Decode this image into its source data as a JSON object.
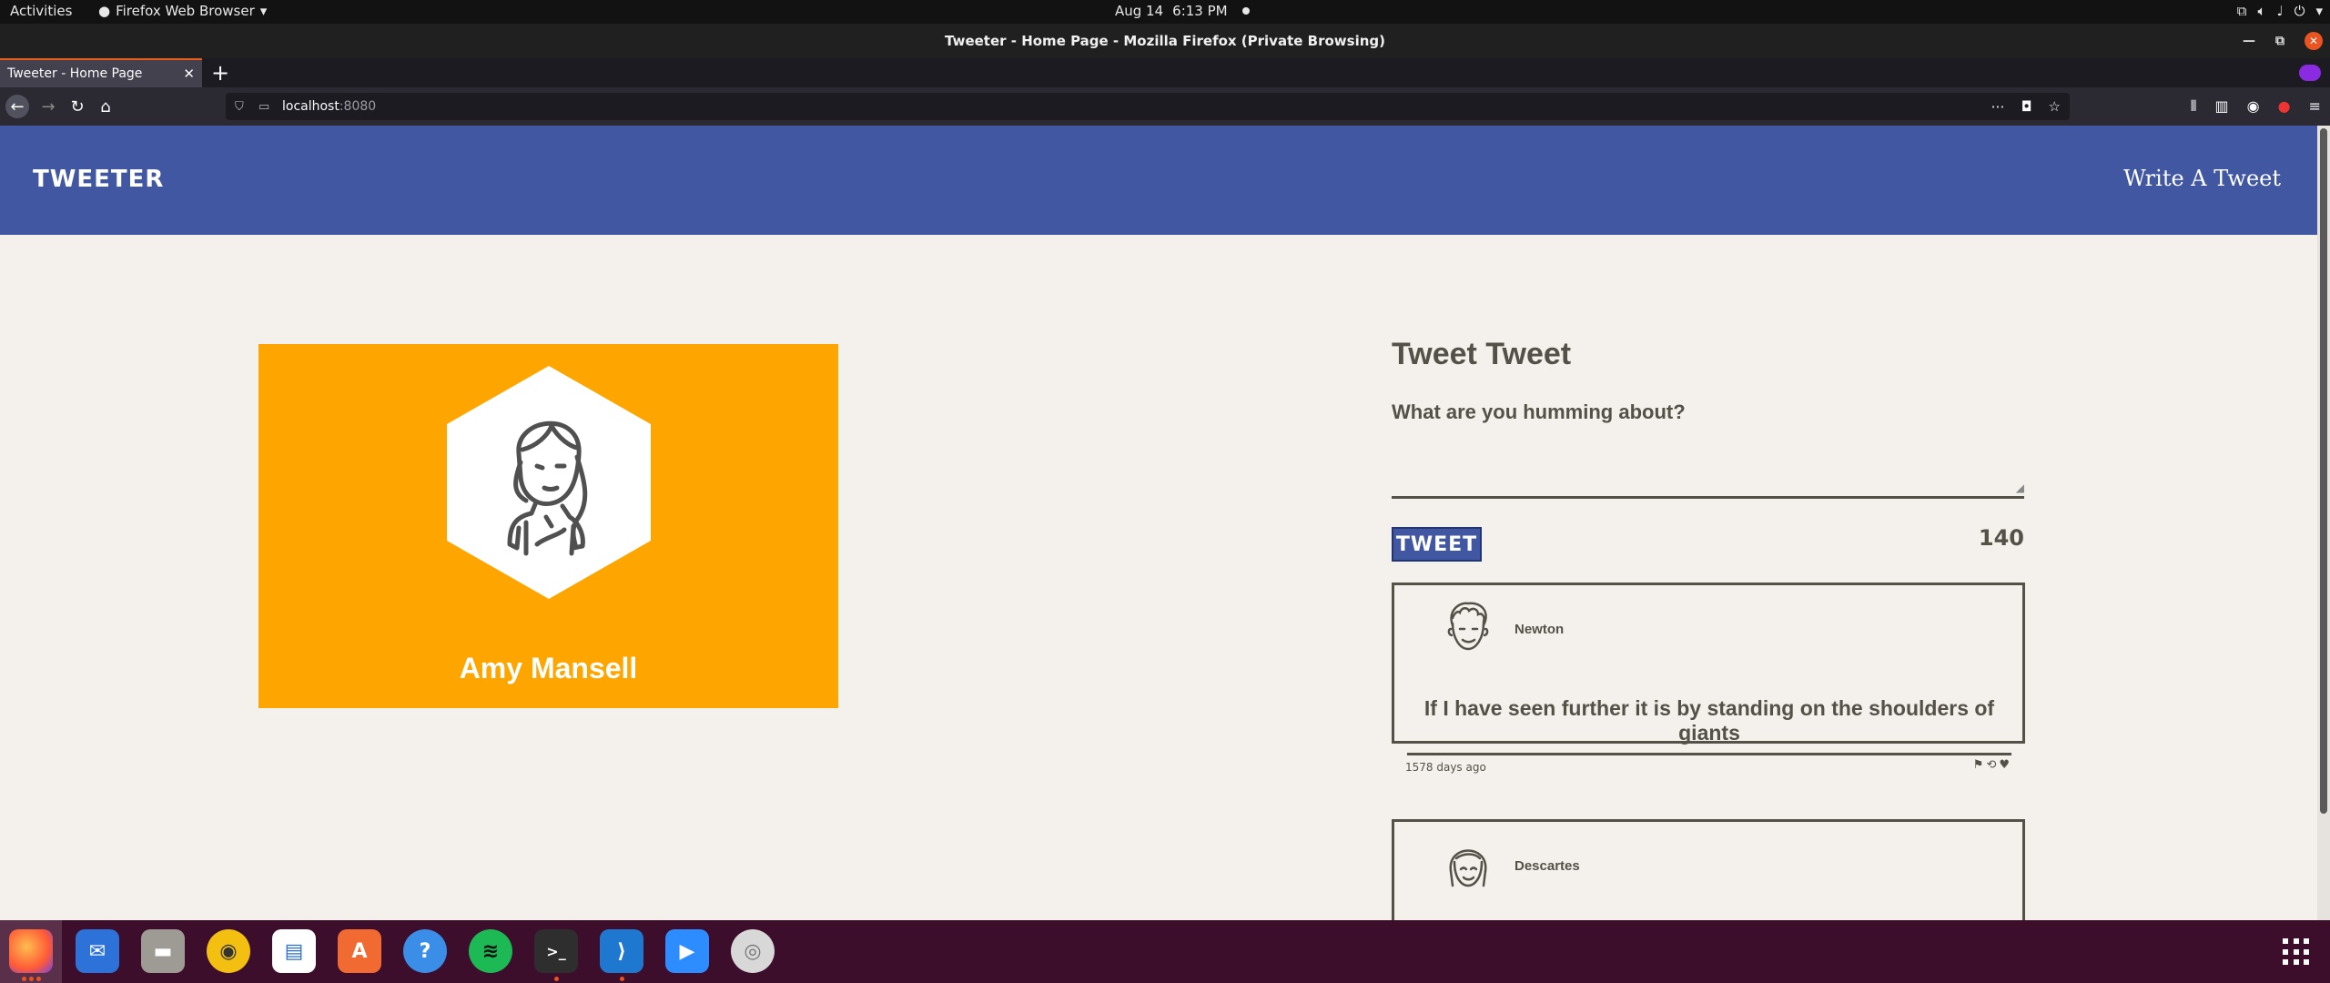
{
  "system_bar": {
    "activities": "Activities",
    "app_menu": "Firefox Web Browser",
    "date": "Aug 14",
    "time": "6:13 PM"
  },
  "window": {
    "title": "Tweeter - Home Page - Mozilla Firefox (Private Browsing)"
  },
  "browser": {
    "tab_title": "Tweeter - Home Page",
    "url_host": "localhost",
    "url_port": ":8080"
  },
  "site": {
    "logo": "TWEETER",
    "nav_write": "Write A Tweet"
  },
  "profile": {
    "name": "Amy Mansell",
    "card_color": "#ffa500"
  },
  "composer": {
    "title": "Tweet Tweet",
    "prompt": "What are you humming about?",
    "button_label": "TWEET",
    "char_count": "140"
  },
  "tweets": [
    {
      "author": "Newton",
      "content": "If I have seen further it is by standing on the shoulders of giants",
      "time": "1578 days ago"
    },
    {
      "author": "Descartes"
    }
  ],
  "colors": {
    "header": "#4157a1",
    "page_bg": "#f4f1ec",
    "text": "#545149",
    "dock_bg": "#3c0e2b"
  },
  "dock": {
    "apps": [
      "firefox",
      "thunderbird",
      "files",
      "rhythmbox",
      "libreoffice-writer",
      "app-center",
      "help",
      "spotify",
      "terminal",
      "vscode",
      "zoom",
      "disc"
    ]
  }
}
